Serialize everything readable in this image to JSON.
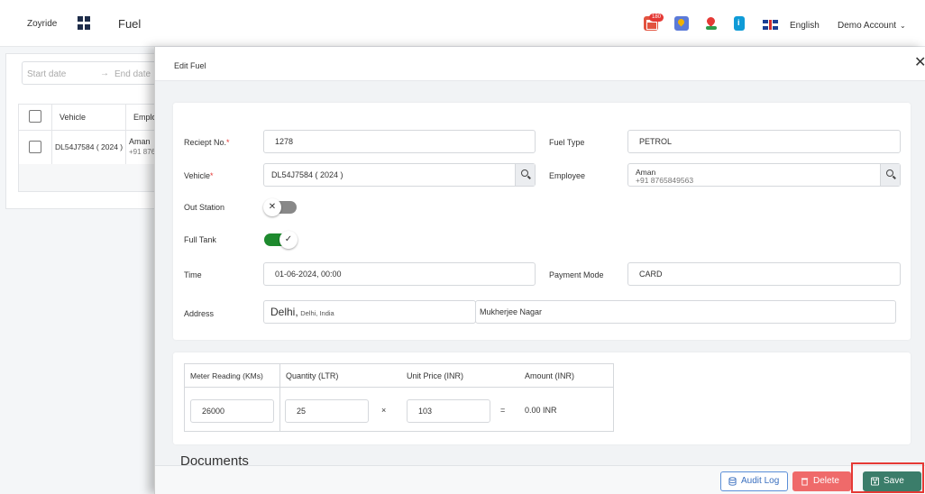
{
  "header": {
    "brand": "Zoyride",
    "page_title": "Fuel",
    "notification_count": "180",
    "language": "English",
    "account": "Demo Account"
  },
  "filters": {
    "start_placeholder": "Start date",
    "end_placeholder": "End date"
  },
  "list_table": {
    "columns": [
      "Vehicle",
      "Emplo"
    ],
    "rows": [
      {
        "vehicle": "DL54J7584 ( 2024 )",
        "employee_name": "Aman",
        "employee_phone": "+91 876"
      }
    ]
  },
  "modal": {
    "title": "Edit Fuel",
    "form": {
      "receipt_label": "Reciept No.",
      "receipt_value": "1278",
      "fuel_type_label": "Fuel Type",
      "fuel_type_value": "PETROL",
      "vehicle_label": "Vehicle",
      "vehicle_value": "DL54J7584 ( 2024 )",
      "employee_label": "Employee",
      "employee_name": "Aman",
      "employee_phone": "+91 8765849563",
      "out_station_label": "Out Station",
      "out_station_on": false,
      "full_tank_label": "Full Tank",
      "full_tank_on": true,
      "time_label": "Time",
      "time_value": "01-06-2024, 00:00",
      "payment_mode_label": "Payment Mode",
      "payment_mode_value": "CARD",
      "address_label": "Address",
      "address_city": "Delhi,",
      "address_region": "Delhi, India",
      "address_locality": "Mukherjee Nagar"
    },
    "meter": {
      "headers": [
        "Meter Reading (KMs)",
        "Quantity (LTR)",
        "Unit Price (INR)",
        "Amount (INR)"
      ],
      "meter_reading": "26000",
      "quantity": "25",
      "times": "×",
      "unit_price": "103",
      "equals": "=",
      "amount": "0.00 INR"
    },
    "documents_heading": "Documents",
    "footer": {
      "audit_label": "Audit Log",
      "delete_label": "Delete",
      "save_label": "Save"
    }
  },
  "colors": {
    "save": "#3b7d6a",
    "delete": "#ef6a6a",
    "audit": "#5b8fd8",
    "toggle_on": "#1e8a2e",
    "toggle_off": "#888888",
    "highlight": "#e53935"
  }
}
